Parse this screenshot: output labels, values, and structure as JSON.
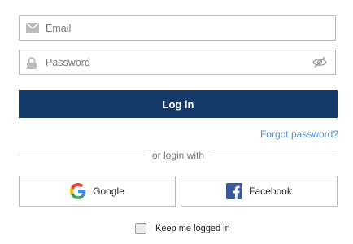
{
  "form": {
    "email": {
      "placeholder": "Email",
      "value": "",
      "icon": "envelope-icon"
    },
    "password": {
      "placeholder": "Password",
      "value": "",
      "icon": "lock-icon",
      "toggle_icon": "eye-slash-icon"
    },
    "login_label": "Log in",
    "forgot_label": "Forgot password?",
    "divider_label": "or login with",
    "google_label": "Google",
    "facebook_label": "Facebook",
    "keep_logged_in_label": "Keep me logged in",
    "keep_logged_in_checked": false
  },
  "colors": {
    "primary": "#143a6a",
    "link": "#4a8fd4",
    "border": "#b8b8b8",
    "facebook": "#3b5998"
  }
}
